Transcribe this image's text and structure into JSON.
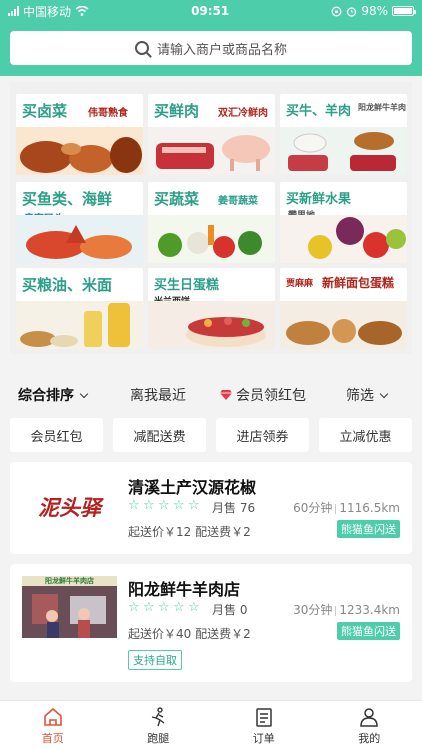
{
  "status_bar": {
    "carrier": "中国移动",
    "time": "09:51",
    "battery": "98%",
    "battery_level": 0.98
  },
  "search": {
    "placeholder": "请输入商户或商品名称"
  },
  "categories": [
    {
      "title": "买卤菜",
      "sub": "伟哥熟食"
    },
    {
      "title": "买鲜肉",
      "sub": "双汇冷鲜肉"
    },
    {
      "title": "买牛、羊肉",
      "sub": "阳龙鲜牛羊肉"
    },
    {
      "title": "买鱼类、海鲜",
      "sub": "皇家码头"
    },
    {
      "title": "买蔬菜",
      "sub": "姜哥蔬菜"
    },
    {
      "title": "买新鲜水果",
      "sub": "攀果地"
    },
    {
      "title": "买粮油、米面",
      "sub": ""
    },
    {
      "title": "买生日蛋糕",
      "sub": "米兰西饼"
    },
    {
      "title": "新鲜面包蛋糕",
      "sub": "贾麻麻"
    }
  ],
  "sort_bar": {
    "comprehensive": "综合排序",
    "nearest": "离我最近",
    "member_packet": "会员领红包",
    "filter": "筛选"
  },
  "chips": [
    "会员红包",
    "减配送费",
    "进店领券",
    "立减优惠"
  ],
  "stores": [
    {
      "name": "清溪土产汉源花椒",
      "logo_text": "泥头驿",
      "rating": 0,
      "sales": "月售 76",
      "time": "60分钟",
      "distance": "1116.5km",
      "min_order": "起送价￥12",
      "delivery_fee": "配送费￥2",
      "delivery": "熊猫鱼闪送",
      "pickup": ""
    },
    {
      "name": "阳龙鲜牛羊肉店",
      "logo_text": "阳龙鲜牛羊肉店",
      "rating": 0,
      "sales": "月售 0",
      "time": "30分钟",
      "distance": "1233.4km",
      "min_order": "起送价￥40",
      "delivery_fee": "配送费￥2",
      "delivery": "熊猫鱼闪送",
      "pickup": "支持自取"
    }
  ],
  "tabs": [
    {
      "label": "首页",
      "icon": "home-icon",
      "active": true
    },
    {
      "label": "跑腿",
      "icon": "runner-icon",
      "active": false
    },
    {
      "label": "订单",
      "icon": "order-icon",
      "active": false
    },
    {
      "label": "我的",
      "icon": "user-icon",
      "active": false
    }
  ],
  "colors": {
    "accent": "#4ecdaa",
    "active_tab": "#e0533a",
    "category_title": "#2c9f86"
  }
}
